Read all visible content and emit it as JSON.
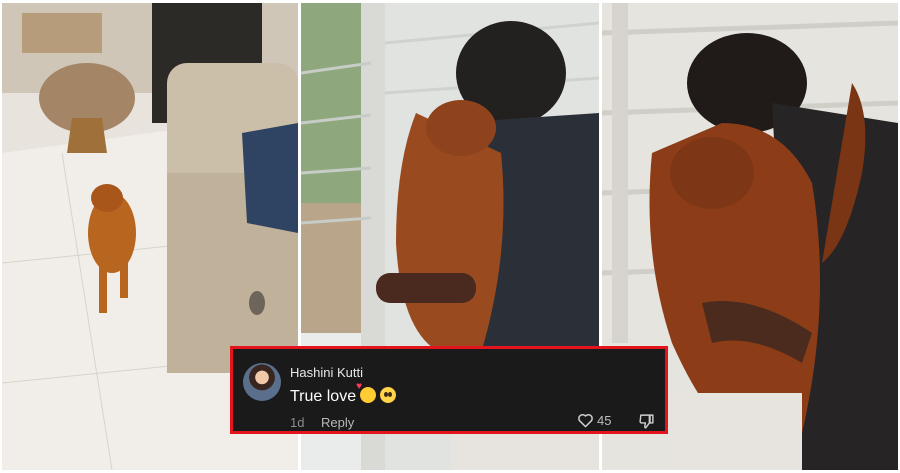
{
  "comment": {
    "username": "Hashini Kutti",
    "text": "True love",
    "emojis": [
      "smiling-face-with-hearts",
      "pleading-face"
    ],
    "time": "1d",
    "reply_label": "Reply",
    "like_count": "45"
  },
  "colors": {
    "comment_background": "#1a1a1a",
    "highlight_border": "#e3141b"
  }
}
